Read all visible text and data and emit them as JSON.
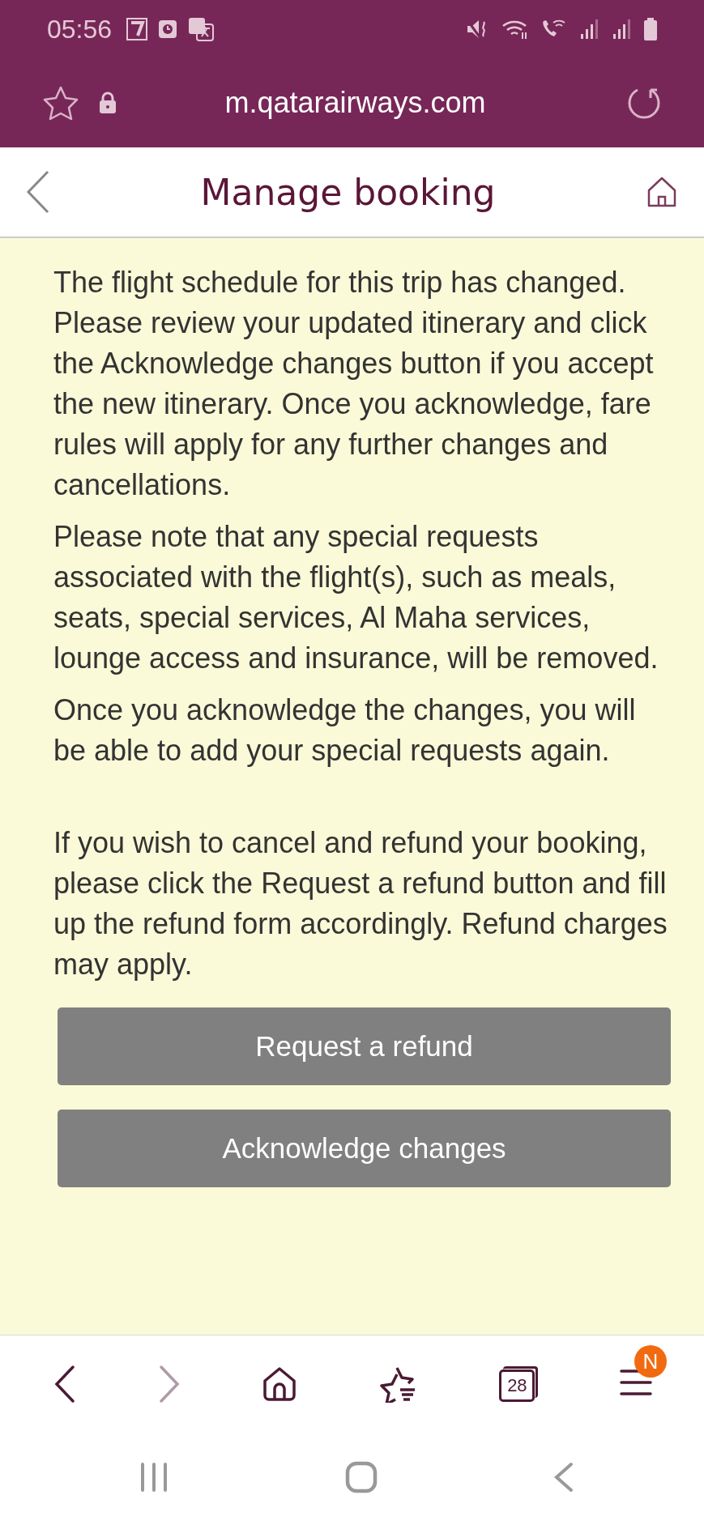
{
  "status_bar": {
    "time": "05:56"
  },
  "browser": {
    "url": "m.qatarairways.com"
  },
  "header": {
    "title": "Manage booking"
  },
  "paragraphs": [
    {
      "text": "The flight schedule for this trip has changed. Please review your updated itinerary and click the Acknowledge changes button if you accept the new itinerary. Once you acknowledge, fare rules will apply for any further changes and cancellations."
    },
    {
      "text": "Please note that any special requests associated with the flight(s), such as meals, seats, special services, Al Maha services, lounge access and insurance, will be removed."
    },
    {
      "text": "Once you acknowledge the changes, you will be able to add your special requests again."
    },
    {
      "text": "If you wish to cancel and refund your booking, please click the Request a refund button and fill up the refund form accordingly. Refund charges may apply."
    }
  ],
  "buttons": [
    "Request a refund",
    "Acknowledge changes"
  ],
  "bottom_nav": [
    {
      "kind": "back",
      "disabled": false
    },
    {
      "kind": "forward",
      "disabled": true
    },
    {
      "kind": "home",
      "disabled": false
    },
    {
      "kind": "bookmarks",
      "disabled": false
    },
    {
      "kind": "tabs",
      "count": "28",
      "disabled": false
    },
    {
      "kind": "menu",
      "badge": "N",
      "disabled": false
    }
  ]
}
